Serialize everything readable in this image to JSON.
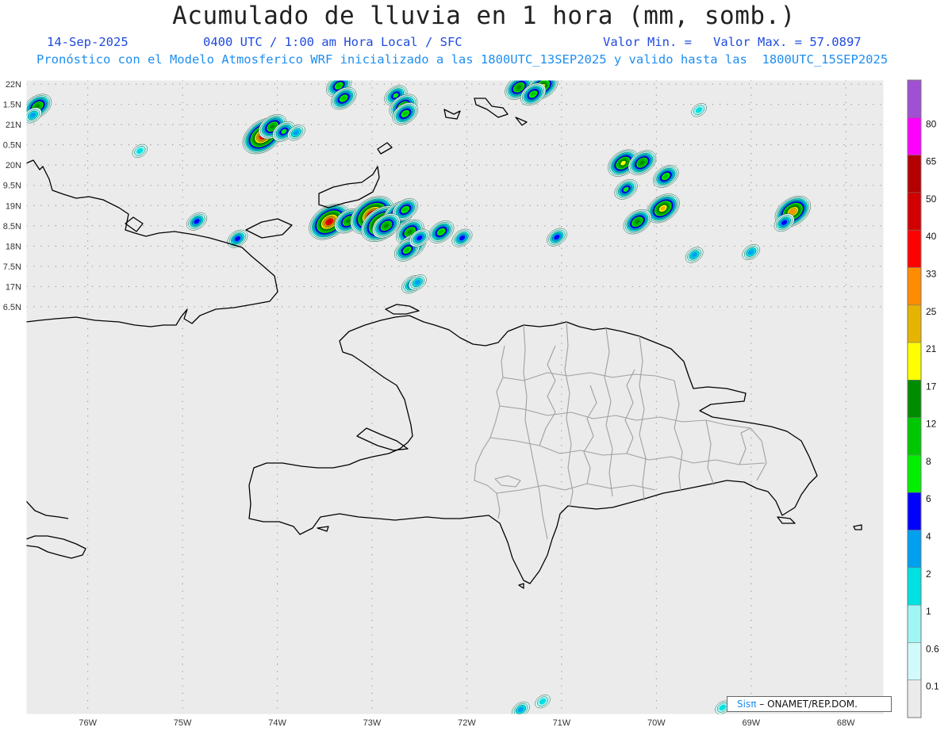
{
  "header": {
    "title": "Acumulado de lluvia en 1 hora (mm, somb.)",
    "date": "14-Sep-2025",
    "time": "0400 UTC / 1:00 am Hora Local / SFC",
    "valor_min": "Valor Min. =",
    "valor_max": "Valor Max. = 57.0897",
    "model": "Pronóstico con el Modelo Atmosferico WRF inicializado a las 1800UTC_13SEP2025 y valido hasta las  1800UTC_15SEP2025"
  },
  "credit": {
    "sis": "Sisπ",
    "org": "– ONAMET/REP.DOM."
  },
  "colors": {
    "background": "#ebebeb",
    "title": "#222222",
    "subtitle": "#1f4be0",
    "model_line": "#1e8ef0",
    "coast": "#000000",
    "borders": "#a0a0a0",
    "grid": "#888888"
  },
  "map": {
    "projection": "lat-lon",
    "lon_range": [
      -76.65,
      -67.6
    ],
    "lat_range": [
      6.43,
      22.1
    ],
    "grid": "dotted",
    "lon_ticks": [
      "76W",
      "75W",
      "74W",
      "73W",
      "72W",
      "71W",
      "70W",
      "69W",
      "68W"
    ],
    "lat_ticks": [
      "22N",
      "1.5N",
      "21N",
      "0.5N",
      "20N",
      "9.5N",
      "19N",
      "8.5N",
      "18N",
      "7.5N",
      "17N",
      "6.5N"
    ]
  },
  "colorbar": {
    "labels": [
      "0.1",
      "0.6",
      "1",
      "2",
      "4",
      "6",
      "8",
      "12",
      "17",
      "21",
      "25",
      "33",
      "40",
      "50",
      "65",
      "80"
    ],
    "colors": [
      "#ebebeb",
      "#d2fafa",
      "#a0f5f5",
      "#00e1e1",
      "#00a0f0",
      "#0000ff",
      "#00f000",
      "#00c800",
      "#008c00",
      "#ffff00",
      "#e6b400",
      "#ff8c00",
      "#ff0000",
      "#d20000",
      "#b40000",
      "#ff00ff",
      "#a050d2"
    ]
  },
  "rain_cells": [
    {
      "lon": -76.53,
      "lat": 21.45,
      "peak": "12"
    },
    {
      "lon": -76.58,
      "lat": 21.23,
      "peak": "2"
    },
    {
      "lon": -74.15,
      "lat": 20.72,
      "peak": "40"
    },
    {
      "lon": -74.05,
      "lat": 20.95,
      "peak": "12"
    },
    {
      "lon": -73.93,
      "lat": 20.83,
      "peak": "6"
    },
    {
      "lon": -73.8,
      "lat": 20.8,
      "peak": "2"
    },
    {
      "lon": -73.35,
      "lat": 21.96,
      "peak": "8"
    },
    {
      "lon": -73.3,
      "lat": 21.65,
      "peak": "8"
    },
    {
      "lon": -72.75,
      "lat": 21.72,
      "peak": "6"
    },
    {
      "lon": -72.67,
      "lat": 21.45,
      "peak": "12"
    },
    {
      "lon": -72.65,
      "lat": 21.27,
      "peak": "8"
    },
    {
      "lon": -71.45,
      "lat": 21.92,
      "peak": "12"
    },
    {
      "lon": -71.2,
      "lat": 21.95,
      "peak": "17"
    },
    {
      "lon": -71.3,
      "lat": 21.75,
      "peak": "8"
    },
    {
      "lon": -70.35,
      "lat": 20.05,
      "peak": "17"
    },
    {
      "lon": -70.15,
      "lat": 20.06,
      "peak": "12"
    },
    {
      "lon": -69.9,
      "lat": 19.72,
      "peak": "8"
    },
    {
      "lon": -70.32,
      "lat": 19.4,
      "peak": "6"
    },
    {
      "lon": -69.93,
      "lat": 18.93,
      "peak": "21"
    },
    {
      "lon": -70.2,
      "lat": 18.6,
      "peak": "12"
    },
    {
      "lon": -68.56,
      "lat": 18.85,
      "peak": "25"
    },
    {
      "lon": -68.65,
      "lat": 18.58,
      "peak": "4"
    },
    {
      "lon": -73.45,
      "lat": 18.6,
      "peak": "40"
    },
    {
      "lon": -73.25,
      "lat": 18.62,
      "peak": "12"
    },
    {
      "lon": -73.0,
      "lat": 18.76,
      "peak": "50"
    },
    {
      "lon": -72.9,
      "lat": 18.55,
      "peak": "40"
    },
    {
      "lon": -72.72,
      "lat": 18.78,
      "peak": "17"
    },
    {
      "lon": -72.65,
      "lat": 18.9,
      "peak": "8"
    },
    {
      "lon": -72.85,
      "lat": 18.5,
      "peak": "12"
    },
    {
      "lon": -72.6,
      "lat": 18.35,
      "peak": "12"
    },
    {
      "lon": -72.27,
      "lat": 18.35,
      "peak": "8"
    },
    {
      "lon": -72.58,
      "lat": 18.0,
      "peak": "12"
    },
    {
      "lon": -72.63,
      "lat": 17.9,
      "peak": "8"
    },
    {
      "lon": -74.85,
      "lat": 18.61,
      "peak": "4"
    },
    {
      "lon": -74.42,
      "lat": 18.18,
      "peak": "4"
    },
    {
      "lon": -72.05,
      "lat": 18.2,
      "peak": "4"
    },
    {
      "lon": -72.5,
      "lat": 18.2,
      "peak": "4"
    },
    {
      "lon": -72.58,
      "lat": 17.05,
      "peak": "4"
    },
    {
      "lon": -72.52,
      "lat": 17.1,
      "peak": "2"
    },
    {
      "lon": -71.43,
      "lat": 6.55,
      "peak": "2"
    },
    {
      "lon": -71.2,
      "lat": 6.75,
      "peak": "1"
    },
    {
      "lon": -71.05,
      "lat": 18.22,
      "peak": "4"
    },
    {
      "lon": -69.55,
      "lat": 21.36,
      "peak": "1"
    },
    {
      "lon": -69.0,
      "lat": 17.85,
      "peak": "2"
    },
    {
      "lon": -69.6,
      "lat": 17.78,
      "peak": "2"
    },
    {
      "lon": -75.45,
      "lat": 20.35,
      "peak": "1"
    },
    {
      "lon": -69.3,
      "lat": 6.6,
      "peak": "1"
    }
  ]
}
